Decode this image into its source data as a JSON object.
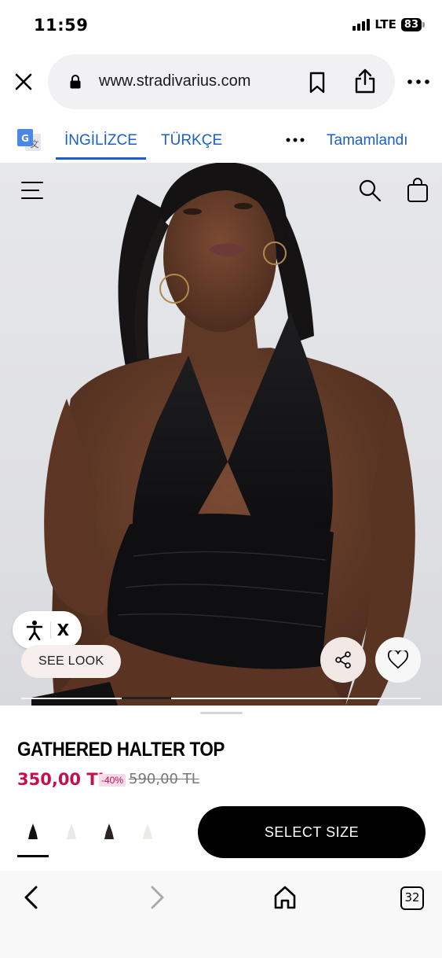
{
  "status_bar": {
    "time": "11:59",
    "network": "LTE",
    "battery": "83"
  },
  "browser": {
    "url": "www.stradivarius.com"
  },
  "translate_bar": {
    "source_lang": "İNGİLİZCE",
    "target_lang": "TÜRKÇE",
    "done_label": "Tamamlandı"
  },
  "hero": {
    "see_look_label": "SEE LOOK",
    "accessibility_close": "X",
    "slide_position": 0.29
  },
  "product": {
    "name": "GATHERED HALTER TOP",
    "price": "350,00 TL",
    "discount": "-40%",
    "old_price": "590,00 TL",
    "swatches": [
      "black",
      "white",
      "dark-brown",
      "cream"
    ],
    "select_size_label": "SELECT SIZE"
  },
  "bottom_nav": {
    "tab_count": "32"
  },
  "colors": {
    "accent_blue": "#1a5fc9",
    "price_red": "#c4104f"
  }
}
